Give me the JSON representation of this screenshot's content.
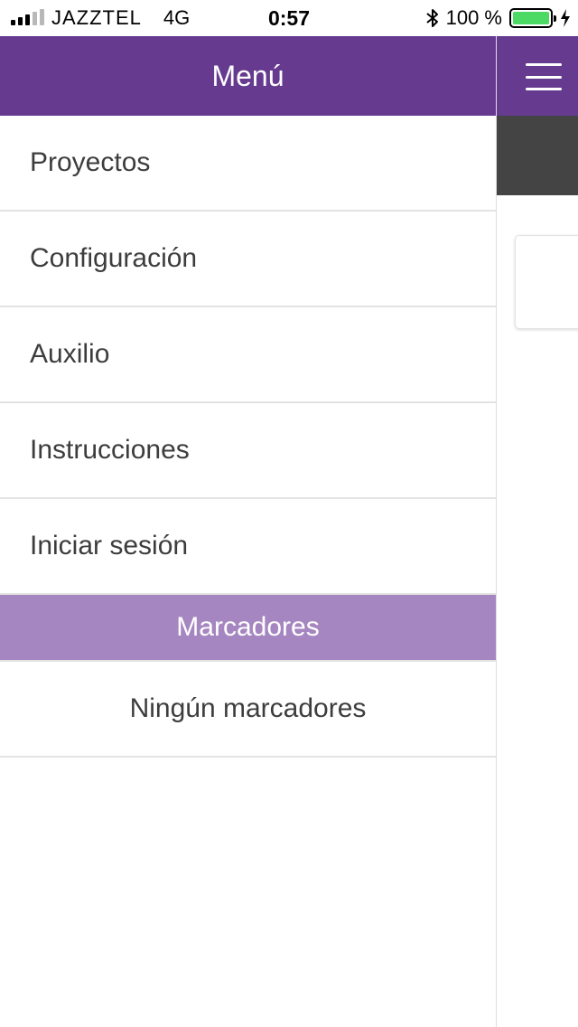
{
  "status_bar": {
    "carrier": "JAZZTEL",
    "network": "4G",
    "time": "0:57",
    "battery_text": "100 %",
    "battery_level": 1.0,
    "signal_bars_on": 3,
    "signal_bars_total": 5
  },
  "drawer": {
    "title": "Menú",
    "items": [
      {
        "label": "Proyectos"
      },
      {
        "label": "Configuración"
      },
      {
        "label": "Auxilio"
      },
      {
        "label": "Instrucciones"
      },
      {
        "label": "Iniciar sesión"
      }
    ],
    "bookmarks_header": "Marcadores",
    "bookmarks_empty": "Ningún marcadores"
  },
  "colors": {
    "header": "#653a8f",
    "section_header": "#a586c0",
    "battery": "#4cd964"
  },
  "icons": {
    "menu_toggle": "hamburger-icon",
    "bluetooth": "bluetooth-icon",
    "charging": "charging-bolt-icon"
  }
}
